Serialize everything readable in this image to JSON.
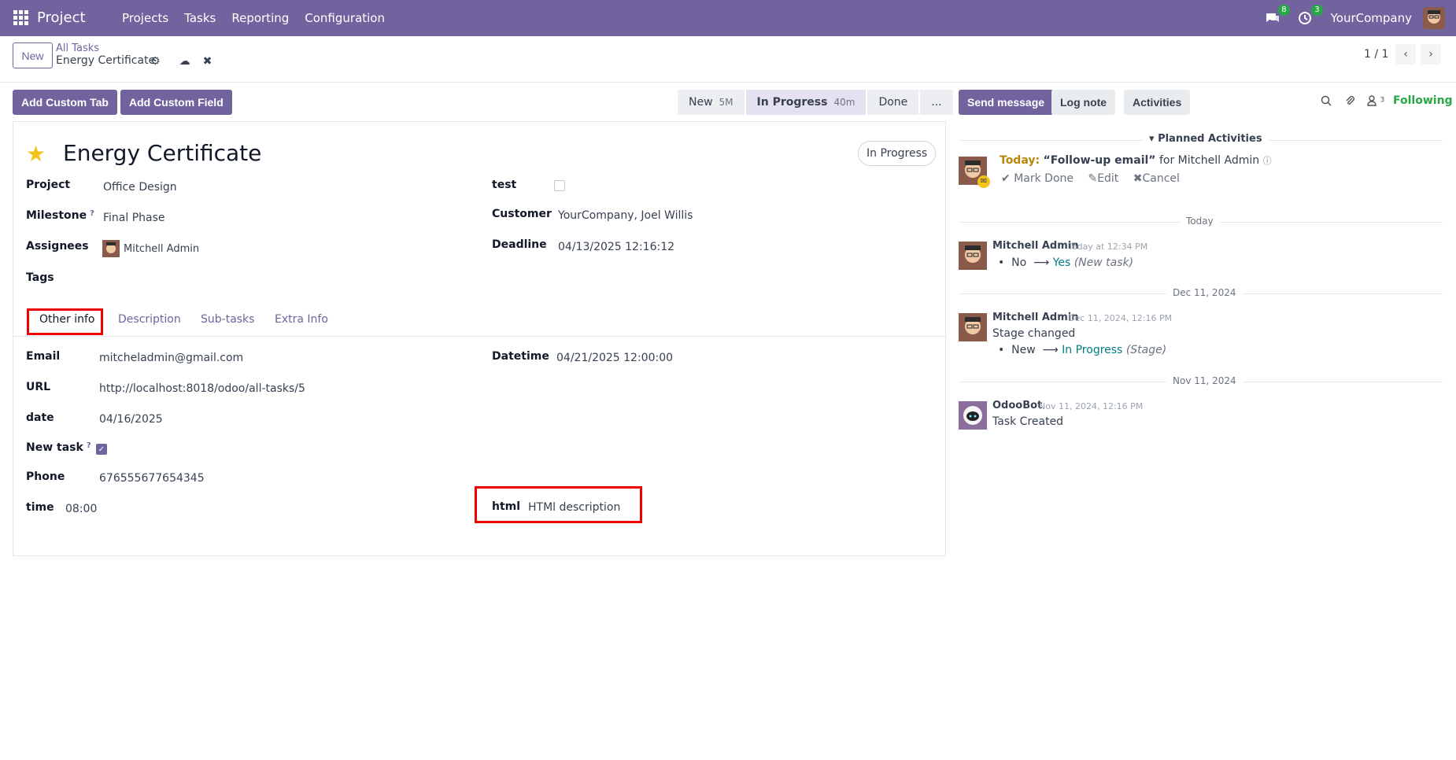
{
  "topbar": {
    "brand": "Project",
    "menu": [
      "Projects",
      "Tasks",
      "Reporting",
      "Configuration"
    ],
    "messages_badge": "8",
    "activities_badge": "3",
    "company": "YourCompany"
  },
  "subbar": {
    "new_label": "New",
    "breadcrumb_parent": "All Tasks",
    "breadcrumb_current": "Energy Certificate",
    "pager": "1 / 1"
  },
  "actions": {
    "add_tab": "Add Custom Tab",
    "add_field": "Add Custom Field"
  },
  "stages": [
    {
      "label": "New",
      "time": "5M"
    },
    {
      "label": "In Progress",
      "time": "40m"
    },
    {
      "label": "Done",
      "time": ""
    },
    {
      "label": "...",
      "time": ""
    }
  ],
  "task": {
    "title": "Energy Certificate",
    "status": "In Progress",
    "project_label": "Project",
    "project": "Office Design",
    "milestone_label": "Milestone",
    "milestone": "Final Phase",
    "assignees_label": "Assignees",
    "assignee": "Mitchell Admin",
    "tags_label": "Tags",
    "test_label": "test",
    "customer_label": "Customer",
    "customer": "YourCompany, Joel Willis",
    "deadline_label": "Deadline",
    "deadline": "04/13/2025 12:16:12"
  },
  "tabs": [
    "Other info",
    "Description",
    "Sub-tasks",
    "Extra Info"
  ],
  "other_info": {
    "email_label": "Email",
    "email": "mitcheladmin@gmail.com",
    "url_label": "URL",
    "url": "http://localhost:8018/odoo/all-tasks/5",
    "date_label": "date",
    "date": "04/16/2025",
    "new_task_label": "New task",
    "phone_label": "Phone",
    "phone": "676555677654345",
    "time_label": "time",
    "time": "08:00",
    "datetime_label": "Datetime",
    "datetime": "04/21/2025 12:00:00",
    "html_label": "html",
    "html": "HTMl description"
  },
  "chatter": {
    "send_message": "Send message",
    "log_note": "Log note",
    "activities": "Activities",
    "followers_count": "3",
    "following": "Following",
    "planned_title": "Planned Activities",
    "planned": {
      "today": "Today:",
      "summary": "“Follow-up email”",
      "for": "for Mitchell Admin",
      "mark_done": "Mark Done",
      "edit": "Edit",
      "cancel": "Cancel"
    },
    "sep_today": "Today",
    "msg1": {
      "author": "Mitchell Admin",
      "time": "Today at 12:34 PM",
      "from": "No",
      "to": "Yes",
      "field": "(New task)"
    },
    "sep_dec": "Dec 11, 2024",
    "msg2": {
      "author": "Mitchell Admin",
      "time": "Dec 11, 2024, 12:16 PM",
      "body": "Stage changed",
      "from": "New",
      "to": "In Progress",
      "field": "(Stage)"
    },
    "sep_nov": "Nov 11, 2024",
    "msg3": {
      "author": "OdooBot",
      "time": "Nov 11, 2024, 12:16 PM",
      "body": "Task Created"
    }
  }
}
